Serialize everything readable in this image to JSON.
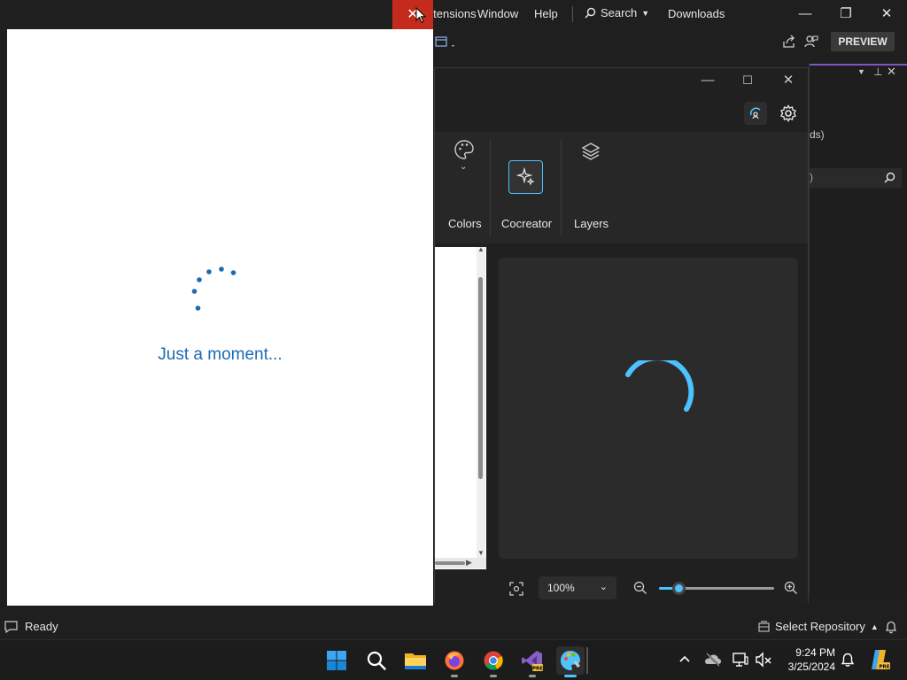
{
  "vs": {
    "menu": {
      "extensions": "Extensions",
      "window": "Window",
      "help": "Help"
    },
    "search_label": "Search",
    "downloads": "Downloads",
    "preview_label": "PREVIEW",
    "right_panel_fragment": "ds)",
    "status": "Ready",
    "select_repo": "Select Repository"
  },
  "paint": {
    "ribbon": {
      "colors": "Colors",
      "cocreator": "Cocreator",
      "layers": "Layers"
    },
    "zoom": {
      "value": "100%",
      "level": 0.17
    }
  },
  "popup": {
    "loading_text": "Just a moment..."
  },
  "taskbar": {
    "apps": [
      "start-icon",
      "search-icon",
      "file-explorer-icon",
      "firefox-icon",
      "chrome-icon",
      "visual-studio-preview-icon",
      "paint-icon"
    ],
    "clock_time": "9:24 PM",
    "clock_date": "3/25/2024"
  },
  "colors": {
    "accent": "#4cc2ff",
    "close_red": "#c42b1c",
    "loading_blue": "#1b6ab4",
    "vs_purple": "#7f56c5"
  }
}
